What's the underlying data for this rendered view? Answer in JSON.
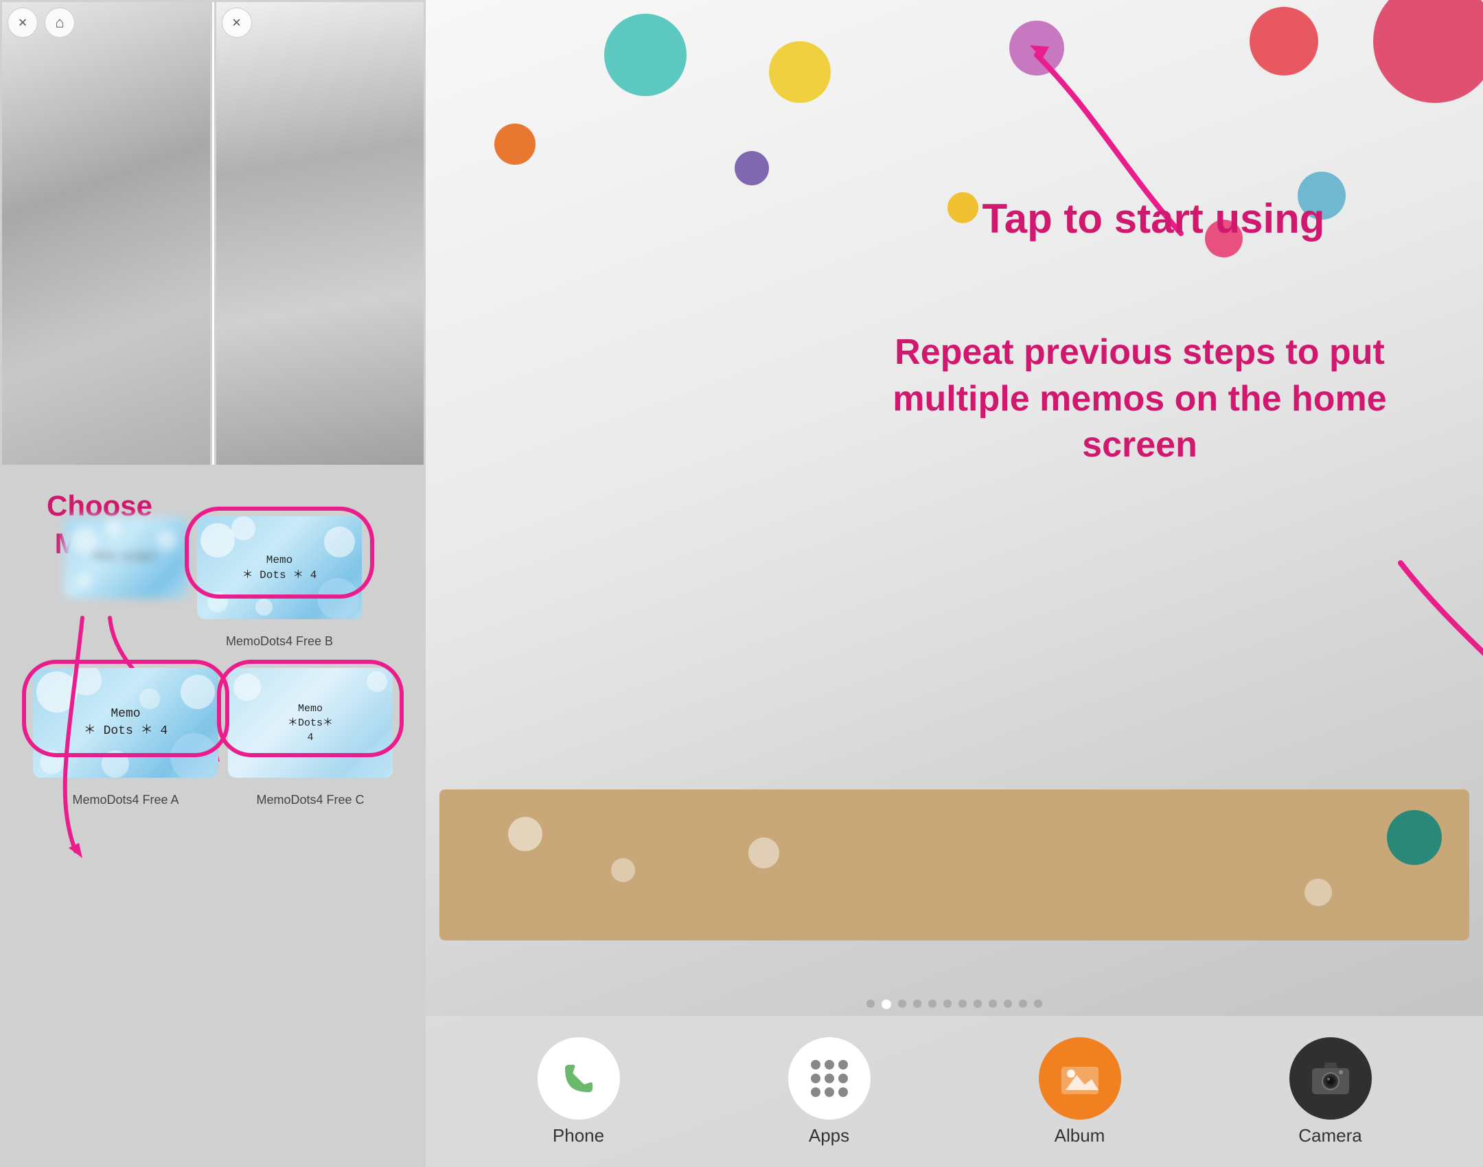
{
  "left_panel": {
    "close_icon_label": "×",
    "home_icon_label": "⌂",
    "widgets": [
      {
        "id": "widget_blurred",
        "label": "",
        "type": "blurred"
      },
      {
        "id": "widget_b",
        "label": "MemoDots4 Free B",
        "type": "memo",
        "memo_text": "Memo\n＊ Dots ＊ 4"
      },
      {
        "id": "widget_a",
        "label": "MemoDots4 Free A",
        "type": "memo",
        "memo_text": "Memo\n＊ Dots ＊ 4"
      },
      {
        "id": "widget_c",
        "label": "MemoDots4 Free C",
        "type": "memo",
        "memo_text": "Memo\n＊Dots＊\n4"
      }
    ],
    "annotation_choose_memo": "Choose MEMO"
  },
  "right_panel": {
    "annotation_tap_start": "Tap to start using",
    "annotation_repeat_steps": "Repeat previous steps to put multiple memos on the home screen",
    "dock": {
      "items": [
        {
          "id": "phone",
          "label": "Phone",
          "icon": "phone"
        },
        {
          "id": "apps",
          "label": "Apps",
          "icon": "apps"
        },
        {
          "id": "album",
          "label": "Album",
          "icon": "album"
        },
        {
          "id": "camera",
          "label": "Camera",
          "icon": "camera"
        }
      ]
    },
    "page_indicators": {
      "total": 12,
      "active_index": 1
    }
  }
}
